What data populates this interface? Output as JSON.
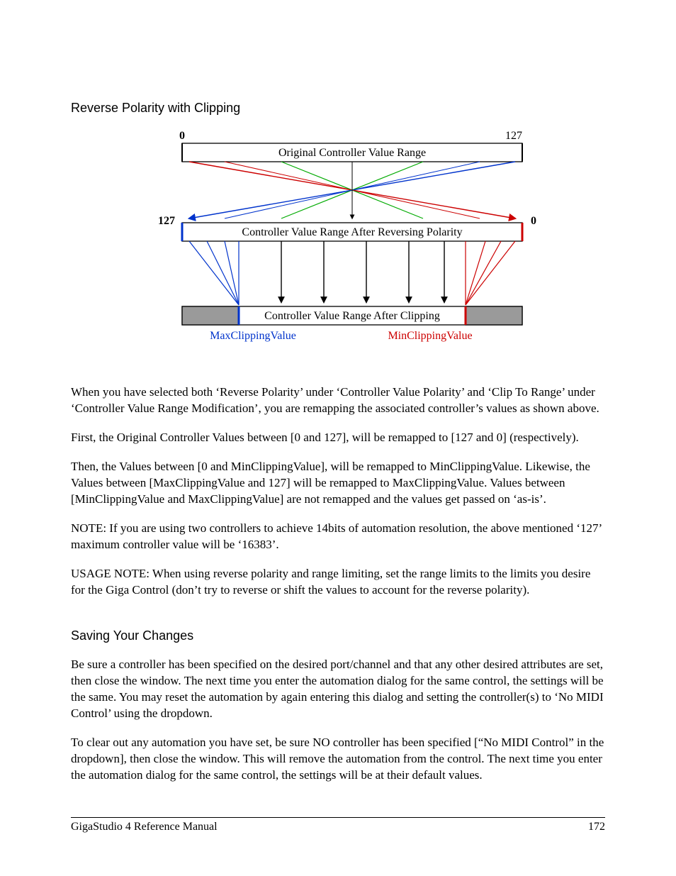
{
  "section1": {
    "title": "Reverse Polarity with Clipping"
  },
  "diagram": {
    "top": {
      "left": "0",
      "right": "127",
      "label": "Original Controller Value Range"
    },
    "mid": {
      "left": "127",
      "right": "0",
      "label": "Controller Value Range After Reversing Polarity"
    },
    "bot": {
      "label": "Controller Value Range After Clipping"
    },
    "maxClip": "MaxClippingValue",
    "minClip": "MinClippingValue"
  },
  "p1": "When you have selected both ‘Reverse Polarity’ under ‘Controller Value Polarity’ and ‘Clip To Range’ under ‘Controller Value Range Modification’, you are remapping the associated controller’s values as shown above.",
  "p2": "First, the Original Controller Values between [0 and 127], will be remapped to [127 and 0] (respectively).",
  "p3": "Then, the Values between [0 and MinClippingValue], will be remapped to MinClippingValue.  Likewise, the Values between [MaxClippingValue and 127] will be remapped to MaxClippingValue.  Values between [MinClippingValue and MaxClippingValue] are not remapped and the values get passed on ‘as-is’.",
  "p4": "NOTE: If you are using two controllers to achieve 14bits of automation resolution, the above mentioned ‘127’ maximum controller value will be ‘16383’.",
  "p5": "USAGE NOTE:  When using reverse polarity and range limiting, set the range limits to the limits you desire for the Giga Control (don’t try to reverse or shift the values to account for the reverse polarity).",
  "section2": {
    "title": "Saving Your Changes"
  },
  "p6": "Be sure a controller has been specified on the desired port/channel and that any other desired attributes are set, then close the window. The next time you enter the automation dialog for the same control, the settings will be the same. You may reset the automation by again entering this dialog and setting the controller(s) to ‘No MIDI Control’ using the dropdown.",
  "p7": "To clear out any automation you have set, be sure NO controller has been specified [“No MIDI Control” in the dropdown], then close the window.  This will remove the automation from the control. The next time you enter the automation dialog for the same control, the settings will be at their default values.",
  "footer": {
    "left": "GigaStudio 4 Reference Manual",
    "right": "172"
  },
  "chart_data": {
    "type": "diagram",
    "stages": [
      {
        "name": "Original Controller Value Range",
        "range": [
          0,
          127
        ]
      },
      {
        "name": "Controller Value Range After Reversing Polarity",
        "range": [
          127,
          0
        ]
      },
      {
        "name": "Controller Value Range After Clipping",
        "clipped_to": [
          "MaxClippingValue",
          "MinClippingValue"
        ]
      }
    ],
    "mappings": [
      {
        "from_stage": 0,
        "to_stage": 1,
        "type": "reverse",
        "notes": "0→127, 127→0, crossing lines"
      },
      {
        "from_stage": 1,
        "to_stage": 2,
        "type": "clip",
        "left_clip_to": "MaxClippingValue",
        "right_clip_to": "MinClippingValue",
        "center": "pass-through"
      }
    ]
  }
}
